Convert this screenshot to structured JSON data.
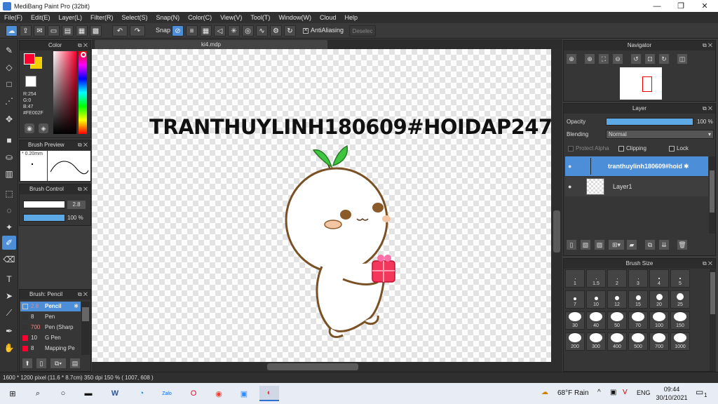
{
  "window": {
    "title": "MediBang Paint Pro (32bit)"
  },
  "menu": [
    "File(F)",
    "Edit(E)",
    "Layer(L)",
    "Filter(R)",
    "Select(S)",
    "Snap(N)",
    "Color(C)",
    "View(V)",
    "Tool(T)",
    "Window(W)",
    "Cloud",
    "Help"
  ],
  "toolbar": {
    "snap_label": "Snap",
    "antialias_label": "AntiAliasing",
    "deselect_label": "Deselec"
  },
  "color_panel": {
    "title": "Color",
    "r": "R:254",
    "g": "G:0",
    "b": "B:47",
    "hex": "#FE002F",
    "fg_color": "#fe002f",
    "bg_color": "#f5d000"
  },
  "brush_preview": {
    "title": "Brush Preview",
    "size": "0.20mm"
  },
  "brush_control": {
    "title": "Brush Control",
    "size_value": "2.8",
    "opacity_value": "100 %",
    "opacity_fraction": 1.0
  },
  "brush_list": {
    "title": "Brush: Pencil",
    "items": [
      {
        "size": "2.8",
        "name": "Pencil",
        "selected": true
      },
      {
        "size": "8",
        "name": "Pen",
        "selected": false
      },
      {
        "size": "700",
        "name": "Pen (Sharp",
        "selected": false
      },
      {
        "size": "10",
        "name": "G Pen",
        "selected": false
      },
      {
        "size": "8",
        "name": "Mapping Pe",
        "selected": false
      }
    ]
  },
  "document": {
    "tab_label": "ki4.mdp"
  },
  "canvas_text": "TRANTHUYLINH180609#HOIDAP247",
  "navigator": {
    "title": "Navigator"
  },
  "layer_panel": {
    "title": "Layer",
    "opacity_label": "Opacity",
    "opacity_value": "100 %",
    "blending_label": "Blending",
    "blending_value": "Normal",
    "protect_alpha": "Protect Alpha",
    "clipping": "Clipping",
    "lock": "Lock",
    "layers": [
      {
        "name": "tranthuylinh180609#hoid",
        "selected": true
      },
      {
        "name": "Layer1",
        "selected": false
      }
    ]
  },
  "brush_size": {
    "title": "Brush Size",
    "sizes": [
      "1",
      "1.5",
      "2",
      "3",
      "4",
      "5",
      "7",
      "10",
      "12",
      "15",
      "20",
      "25",
      "30",
      "40",
      "50",
      "70",
      "100",
      "150",
      "200",
      "300",
      "400",
      "500",
      "700",
      "1000"
    ]
  },
  "status": {
    "text": "1600 * 1200 pixel   (11.6 * 8.7cm)   350 dpi   150 %   ( 1007, 608 )"
  },
  "taskbar": {
    "weather": "68°F  Rain",
    "lang": "ENG",
    "time": "09:44",
    "date": "30/10/2021",
    "notif": "1"
  }
}
